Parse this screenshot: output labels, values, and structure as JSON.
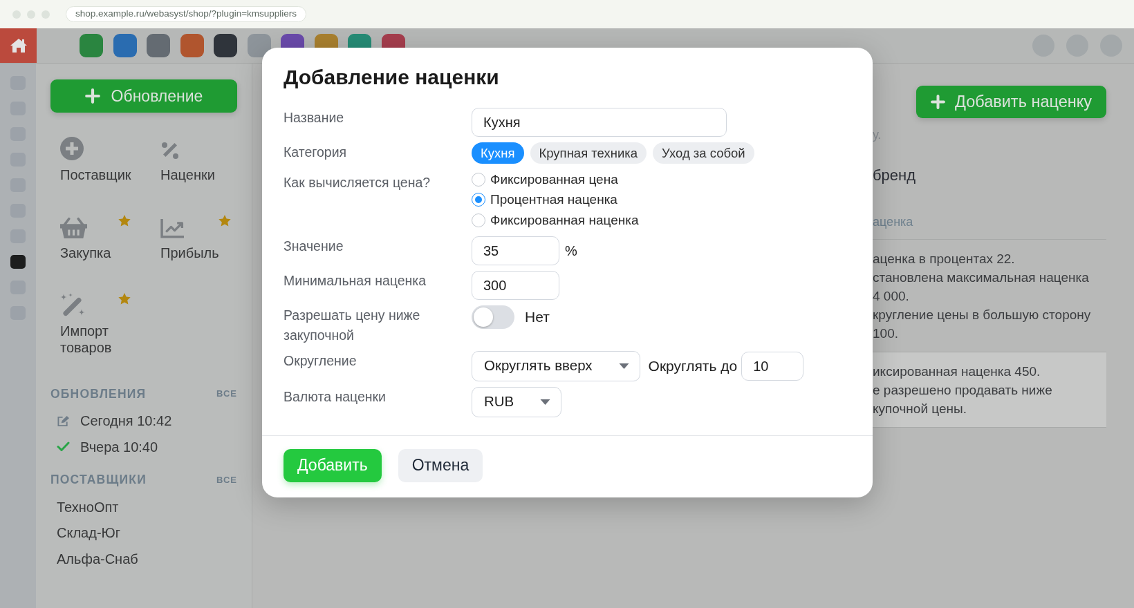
{
  "browser": {
    "url": "shop.example.ru/webasyst/shop/?plugin=kmsuppliers"
  },
  "app_bar": {
    "apps": [
      {
        "color": "#2a8540"
      },
      {
        "color": "#2a6cb0"
      },
      {
        "color": "#646b72"
      },
      {
        "color": "#b0552e"
      },
      {
        "color": "#2f343b"
      },
      {
        "color": "#8e959b"
      },
      {
        "color": "#6a4aab"
      },
      {
        "color": "#a9802f"
      },
      {
        "color": "#268c76"
      },
      {
        "color": "#a63e4e"
      }
    ]
  },
  "rail": {
    "items": [
      {
        "selected": false
      },
      {
        "selected": false
      },
      {
        "selected": false
      },
      {
        "selected": false
      },
      {
        "selected": false
      },
      {
        "selected": false
      },
      {
        "selected": false
      },
      {
        "selected": true
      },
      {
        "selected": false
      },
      {
        "selected": false
      }
    ]
  },
  "sidebar": {
    "new_button": "Обновление",
    "tiles": [
      {
        "kind": "add",
        "label": "Поставщик",
        "starred": false
      },
      {
        "kind": "percent",
        "label": "Наценки",
        "starred": false
      },
      {
        "kind": "basket",
        "label": "Закупка",
        "starred": true
      },
      {
        "kind": "chart",
        "label": "Прибыль",
        "starred": true
      },
      {
        "kind": "wand",
        "label": "Импорт товаров",
        "starred": true
      }
    ],
    "sections": [
      {
        "title": "ОБНОВЛЕНИЯ",
        "all_link": "ВСЕ",
        "items": [
          {
            "kind": "edited",
            "label": "Сегодня 10:42"
          },
          {
            "kind": "done",
            "label": "Вчера 10:40"
          }
        ]
      },
      {
        "title": "ПОСТАВЩИКИ",
        "all_link": "ВСЕ",
        "items": [
          {
            "kind": "plain",
            "label": "ТехноОпт"
          },
          {
            "kind": "plain",
            "label": "Склад-Юг"
          },
          {
            "kind": "plain",
            "label": "Альфа-Снаб"
          }
        ]
      }
    ]
  },
  "main": {
    "add_button": "Добавить наценку",
    "hint": "у.",
    "heading": "бренд",
    "column_header": "аценка",
    "rows": [
      {
        "highlighted": false,
        "lines": [
          "аценка в процентах 22.",
          "становлена максимальная наценка",
          "4 000.",
          "кругление цены в большую сторону",
          "100."
        ]
      },
      {
        "highlighted": true,
        "lines": [
          "иксированная наценка 450.",
          "е разрешено продавать ниже",
          "купочной цены."
        ]
      }
    ]
  },
  "modal": {
    "title": "Добавление наценки",
    "fields": [
      {
        "kind": "text",
        "label": "Название",
        "value": "Кухня"
      },
      {
        "kind": "chips",
        "label": "Категория",
        "options": [
          {
            "label": "Кухня",
            "selected": true
          },
          {
            "label": "Крупная техника",
            "selected": false
          },
          {
            "label": "Уход за собой",
            "selected": false
          }
        ]
      },
      {
        "kind": "radio",
        "label": "Как вычисляется цена?",
        "options": [
          {
            "label": "Фиксированная цена",
            "selected": false
          },
          {
            "label": "Процентная наценка",
            "selected": true
          },
          {
            "label": "Фиксированная наценка",
            "selected": false
          }
        ]
      },
      {
        "kind": "number",
        "label": "Значение",
        "value": "35",
        "unit": "%"
      },
      {
        "kind": "number",
        "label": "Минимальная наценка",
        "value": "300"
      },
      {
        "kind": "toggle",
        "label": "Разрешать цену ниже закупочной",
        "on": false,
        "state_label": "Нет"
      },
      {
        "kind": "select",
        "label": "Округление",
        "value": "Округлять вверх",
        "extra_label": "Округлять до",
        "extra_value": "10"
      },
      {
        "kind": "select",
        "label": "Валюта наценки",
        "value": "RUB"
      }
    ],
    "buttons": [
      {
        "kind": "primary",
        "label": "Добавить"
      },
      {
        "kind": "secondary",
        "label": "Отмена"
      }
    ]
  }
}
